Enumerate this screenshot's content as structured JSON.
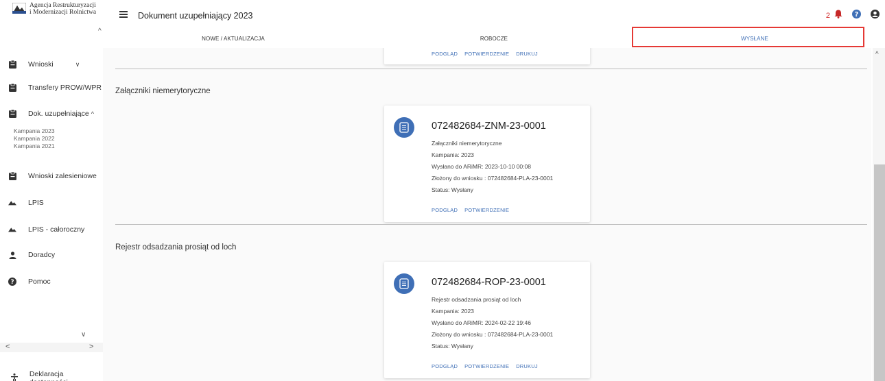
{
  "app": {
    "logo_line1": "Agencja Restrukturyzacji",
    "logo_line2": "i Modernizacji Rolnictwa"
  },
  "sidebar": {
    "items": [
      {
        "label": "Wnioski",
        "icon": "clipboard-icon",
        "chevron": "∨"
      },
      {
        "label": "Transfery PROW/WPR",
        "icon": "clipboard-icon"
      },
      {
        "label": "Dok. uzupełniające",
        "icon": "clipboard-icon",
        "chevron": "^"
      },
      {
        "label": "Wnioski zalesieniowe",
        "icon": "clipboard-icon"
      },
      {
        "label": "LPIS",
        "icon": "landscape-icon"
      },
      {
        "label": "LPIS - całoroczny",
        "icon": "landscape-icon"
      },
      {
        "label": "Doradcy",
        "icon": "person-icon"
      },
      {
        "label": "Pomoc",
        "icon": "help-icon"
      }
    ],
    "sub_items": [
      "Kampania 2023",
      "Kampania 2022",
      "Kampania 2021"
    ],
    "footer": "Deklaracja dostępności"
  },
  "header": {
    "title": "Dokument uzupełniający 2023",
    "notification_count": "2"
  },
  "tabs": [
    {
      "label": "NOWE / AKTUALIZACJA"
    },
    {
      "label": "ROBOCZE"
    },
    {
      "label": "WYSŁANE"
    }
  ],
  "sections": [
    {
      "title": "Załączniki niemerytoryczne",
      "card": {
        "id": "072482684-ZNM-23-0001",
        "type": "Załączniki niemerytoryczne",
        "campaign": "Kampania: 2023",
        "sent": "Wysłano do ARiMR: 2023-10-10 00:08",
        "attached": "Złożony do wniosku : 072482684-PLA-23-0001",
        "status": "Status: Wysłany",
        "actions": [
          "PODGLĄD",
          "POTWIERDZENIE"
        ]
      }
    },
    {
      "title": "Rejestr odsadzania prosiąt od loch",
      "card": {
        "id": "072482684-ROP-23-0001",
        "type": "Rejestr odsadzania prosiąt od loch",
        "campaign": "Kampania: 2023",
        "sent": "Wysłano do ARiMR: 2024-02-22 19:46",
        "attached": "Złożony do wniosku : 072482684-PLA-23-0001",
        "status": "Status: Wysłany",
        "actions": [
          "PODGLĄD",
          "POTWIERDZENIE",
          "DRUKUJ"
        ]
      }
    }
  ],
  "top_card_actions": [
    "PODGLĄD",
    "POTWIERDZENIE",
    "DRUKUJ"
  ],
  "colors": {
    "accent": "#3f6fb6",
    "highlight": "#e53935",
    "notification": "#d32f2f"
  }
}
